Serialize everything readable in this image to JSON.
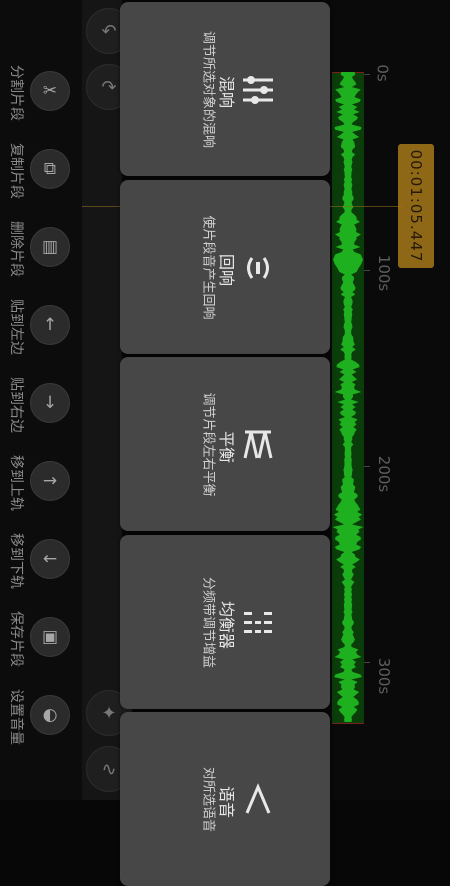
{
  "tools": [
    {
      "label": "分割片段",
      "icon": "scissors-icon",
      "glyph": "✂"
    },
    {
      "label": "复制片段",
      "icon": "copy-icon",
      "glyph": "⧉"
    },
    {
      "label": "删除片段",
      "icon": "trash-icon",
      "glyph": "🗑"
    },
    {
      "label": "贴到左边",
      "icon": "arrow-up-icon",
      "glyph": "↑"
    },
    {
      "label": "贴到右边",
      "icon": "arrow-down-icon",
      "glyph": "↓"
    },
    {
      "label": "移到上轨",
      "icon": "arrow-right-icon",
      "glyph": "→"
    },
    {
      "label": "移到下轨",
      "icon": "arrow-left-icon",
      "glyph": "←"
    },
    {
      "label": "保存片段",
      "icon": "save-icon",
      "glyph": "▣"
    },
    {
      "label": "设置音量",
      "icon": "volume-icon",
      "glyph": "◐"
    }
  ],
  "timeline": {
    "time": "00:01:05.447",
    "ticks": [
      "0s",
      "100s",
      "200s",
      "300s"
    ]
  },
  "effects": [
    {
      "title": "混响",
      "desc": "调节所选对象的混响",
      "icon": "sliders-icon"
    },
    {
      "title": "回响",
      "desc": "使片段音产生回响",
      "icon": "echo-icon"
    },
    {
      "title": "平衡",
      "desc": "调节片段左右平衡",
      "icon": "balance-icon"
    },
    {
      "title": "均衡器",
      "desc": "分频带调节增益",
      "icon": "equalizer-icon"
    },
    {
      "title": "语音",
      "desc": "对所选语音",
      "icon": "voice-icon"
    }
  ]
}
